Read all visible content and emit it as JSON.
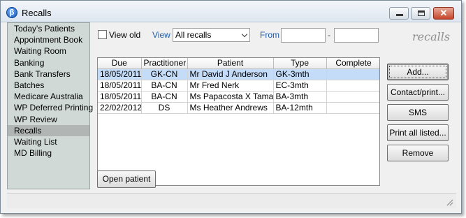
{
  "window": {
    "title": "Recalls",
    "app_icon": "app-logo-icon"
  },
  "sidebar": {
    "items": [
      {
        "label": "Today's Patients"
      },
      {
        "label": "Appointment Book"
      },
      {
        "label": "Waiting Room"
      },
      {
        "label": "Banking"
      },
      {
        "label": "Bank Transfers"
      },
      {
        "label": "Batches"
      },
      {
        "label": "Medicare Australia"
      },
      {
        "label": "WP Deferred Printing"
      },
      {
        "label": "WP Review"
      },
      {
        "label": "Recalls",
        "selected": true
      },
      {
        "label": "Waiting List"
      },
      {
        "label": "MD Billing"
      }
    ]
  },
  "filters": {
    "view_old_label": "View old",
    "view_old_checked": false,
    "view_label": "View",
    "view_value": "All recalls",
    "from_label": "From",
    "from_value": "",
    "to_value": "",
    "range_separator": "-"
  },
  "watermark": "recalls",
  "table": {
    "columns": [
      "Due",
      "Practitioner",
      "Patient",
      "Type",
      "Complete"
    ],
    "rows": [
      {
        "due": "18/05/2011",
        "practitioner": "GK-CN",
        "patient": "Mr David J Anderson",
        "type": "GK-3mth",
        "complete": "",
        "selected": true
      },
      {
        "due": "18/05/2011",
        "practitioner": "BA-CN",
        "patient": "Mr Fred Nerk",
        "type": "EC-3mth",
        "complete": ""
      },
      {
        "due": "18/05/2011",
        "practitioner": "BA-CN",
        "patient": "Ms Papacosta X Tamara",
        "type": "BA-3mth",
        "complete": ""
      },
      {
        "due": "22/02/2012",
        "practitioner": "DS",
        "patient": "Ms Heather Andrews",
        "type": "BA-12mth",
        "complete": ""
      }
    ]
  },
  "actions": {
    "add": "Add...",
    "contact_print": "Contact/print...",
    "sms": "SMS",
    "print_all": "Print all listed...",
    "remove": "Remove"
  },
  "open_patient": "Open patient",
  "colors": {
    "selected_row": "#c4dcf8",
    "sidebar_bg": "#d0d9d6",
    "sidebar_selected": "#b1b5b4",
    "label_blue": "#1e5aa8"
  }
}
